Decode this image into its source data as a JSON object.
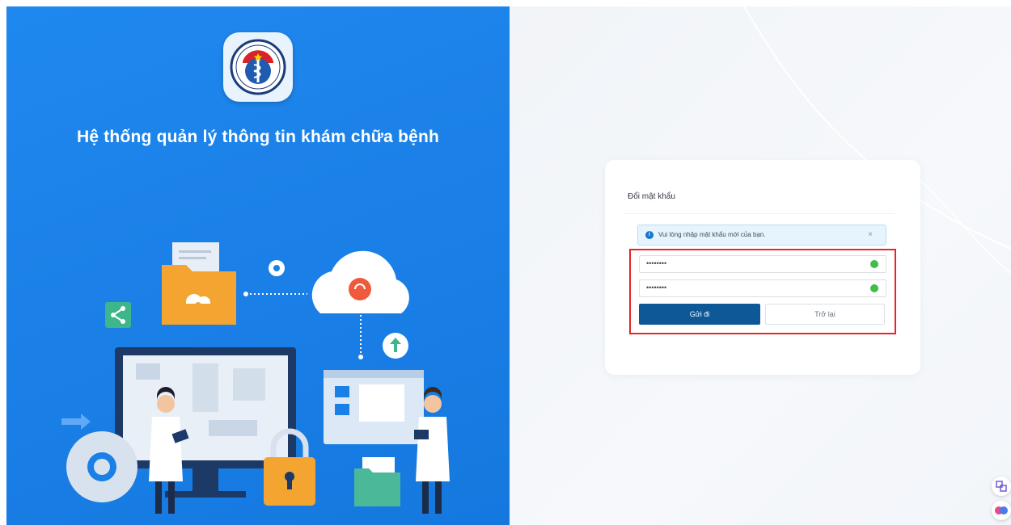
{
  "left": {
    "headline": "Hệ thống quản lý thông tin khám chữa bệnh"
  },
  "card": {
    "title": "Đổi mật khẩu",
    "alert": {
      "text": "Vui lòng nhập mật khẩu mới của bạn.",
      "close": "×"
    },
    "fields": {
      "new_password": {
        "value": "••••••••"
      },
      "confirm_password": {
        "value": "••••••••"
      }
    },
    "submit_label": "Gửi đi",
    "back_label": "Trở lại"
  },
  "colors": {
    "primary_blue": "#1a7fe6",
    "button_blue": "#0e5897",
    "highlight_red": "#e52424",
    "success_green": "#3fbf4a"
  },
  "icons": {
    "logo": "ministry-of-health-logo",
    "alert": "info-icon",
    "field_valid": "check-circle-icon",
    "float_top": "translate-icon",
    "float_bottom": "assistant-icon"
  }
}
